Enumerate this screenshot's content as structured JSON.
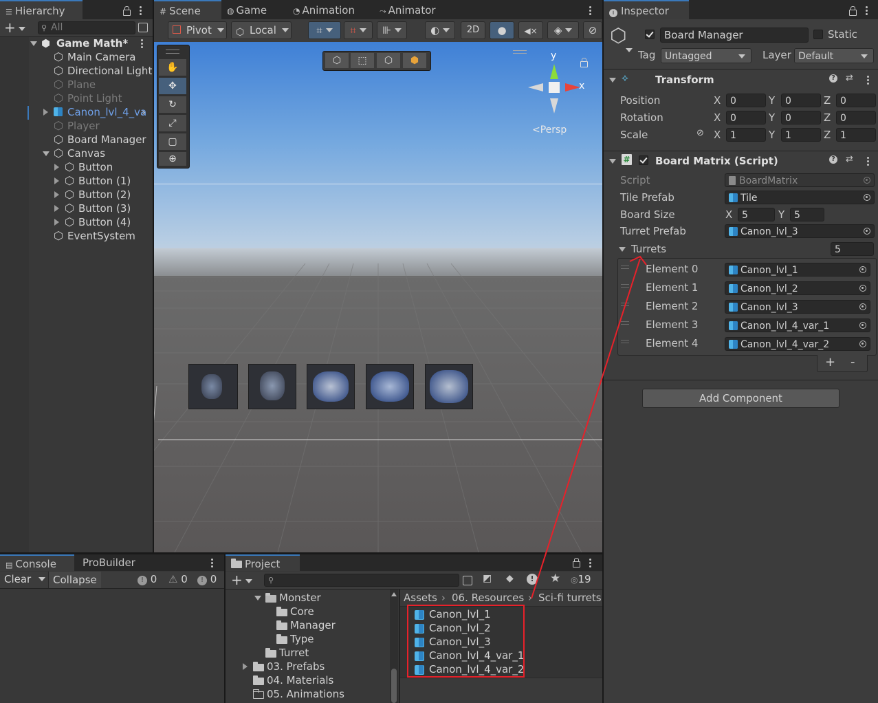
{
  "hierarchy": {
    "tab": "Hierarchy",
    "search_placeholder": "All",
    "scene": "Game Math*",
    "items": [
      {
        "label": "Main Camera",
        "indent": 1,
        "style": "normal",
        "icon": "cube-icon"
      },
      {
        "label": "Directional Light",
        "indent": 1,
        "style": "normal",
        "icon": "cube-icon"
      },
      {
        "label": "Plane",
        "indent": 1,
        "style": "dim",
        "icon": "cube-icon"
      },
      {
        "label": "Point Light",
        "indent": 1,
        "style": "dim",
        "icon": "cube-icon"
      },
      {
        "label": "Canon_lvl_4_va",
        "indent": 1,
        "style": "blue",
        "icon": "prefab-icon"
      },
      {
        "label": "Player",
        "indent": 1,
        "style": "dim",
        "icon": "cube-icon"
      },
      {
        "label": "Board Manager",
        "indent": 1,
        "style": "normal",
        "icon": "cube-icon"
      },
      {
        "label": "Canvas",
        "indent": 1,
        "style": "normal",
        "icon": "cube-icon"
      },
      {
        "label": "Button",
        "indent": 2,
        "style": "normal",
        "icon": "cube-icon"
      },
      {
        "label": "Button (1)",
        "indent": 2,
        "style": "normal",
        "icon": "cube-icon"
      },
      {
        "label": "Button (2)",
        "indent": 2,
        "style": "normal",
        "icon": "cube-icon"
      },
      {
        "label": "Button (3)",
        "indent": 2,
        "style": "normal",
        "icon": "cube-icon"
      },
      {
        "label": "Button (4)",
        "indent": 2,
        "style": "normal",
        "icon": "cube-icon"
      },
      {
        "label": "EventSystem",
        "indent": 1,
        "style": "normal",
        "icon": "cube-icon"
      }
    ]
  },
  "scene_view": {
    "tabs": [
      "Scene",
      "Game",
      "Animation",
      "Animator"
    ],
    "pivot": "Pivot",
    "local": "Local",
    "mode_2d": "2D",
    "gizmo_y": "y",
    "gizmo_x": "x",
    "persp": "<Persp"
  },
  "inspector": {
    "tab": "Inspector",
    "object_name": "Board Manager",
    "static_label": "Static",
    "tag_label": "Tag",
    "tag_value": "Untagged",
    "layer_label": "Layer",
    "layer_value": "Default",
    "transform": {
      "title": "Transform",
      "rows": [
        {
          "label": "Position",
          "x": "0",
          "y": "0",
          "z": "0"
        },
        {
          "label": "Rotation",
          "x": "0",
          "y": "0",
          "z": "0"
        },
        {
          "label": "Scale",
          "x": "1",
          "y": "1",
          "z": "1"
        }
      ],
      "axis": [
        "X",
        "Y",
        "Z"
      ]
    },
    "script_component": {
      "title": "Board Matrix (Script)",
      "script_label": "Script",
      "script_value": "BoardMatrix",
      "tile_label": "Tile Prefab",
      "tile_value": "Tile",
      "board_label": "Board Size",
      "board_x": "5",
      "board_y": "5",
      "turret_label": "Turret Prefab",
      "turret_value": "Canon_lvl_3",
      "turrets_label": "Turrets",
      "turrets_count": "5",
      "elements": [
        {
          "label": "Element 0",
          "value": "Canon_lvl_1"
        },
        {
          "label": "Element 1",
          "value": "Canon_lvl_2"
        },
        {
          "label": "Element 2",
          "value": "Canon_lvl_3"
        },
        {
          "label": "Element 3",
          "value": "Canon_lvl_4_var_1"
        },
        {
          "label": "Element 4",
          "value": "Canon_lvl_4_var_2"
        }
      ],
      "plus": "+",
      "minus": "-"
    },
    "add_component": "Add Component"
  },
  "console": {
    "tabs": [
      "Console",
      "ProBuilder"
    ],
    "clear": "Clear",
    "collapse": "Collapse",
    "counts": [
      "0",
      "0",
      "0"
    ]
  },
  "project": {
    "tab": "Project",
    "hidden_count": "19",
    "tree": [
      {
        "label": "Monster",
        "indent": 2,
        "arrow": "down",
        "folder": "open"
      },
      {
        "label": "Core",
        "indent": 3,
        "arrow": "none",
        "folder": "closed"
      },
      {
        "label": "Manager",
        "indent": 3,
        "arrow": "none",
        "folder": "closed"
      },
      {
        "label": "Type",
        "indent": 3,
        "arrow": "none",
        "folder": "closed"
      },
      {
        "label": "Turret",
        "indent": 2,
        "arrow": "none",
        "folder": "closed"
      },
      {
        "label": "03. Prefabs",
        "indent": 1,
        "arrow": "right",
        "folder": "closed"
      },
      {
        "label": "04. Materials",
        "indent": 1,
        "arrow": "none",
        "folder": "closed"
      },
      {
        "label": "05. Animations",
        "indent": 1,
        "arrow": "none",
        "folder": "outline"
      }
    ],
    "breadcrumb": [
      "Assets",
      "06. Resources",
      "Sci-fi turrets"
    ],
    "assets": [
      "Canon_lvl_1",
      "Canon_lvl_2",
      "Canon_lvl_3",
      "Canon_lvl_4_var_1",
      "Canon_lvl_4_var_2"
    ]
  },
  "colors": {
    "annotation": "#e8212a",
    "selection": "#3a79bb",
    "prefab": "#4fb3e8"
  }
}
